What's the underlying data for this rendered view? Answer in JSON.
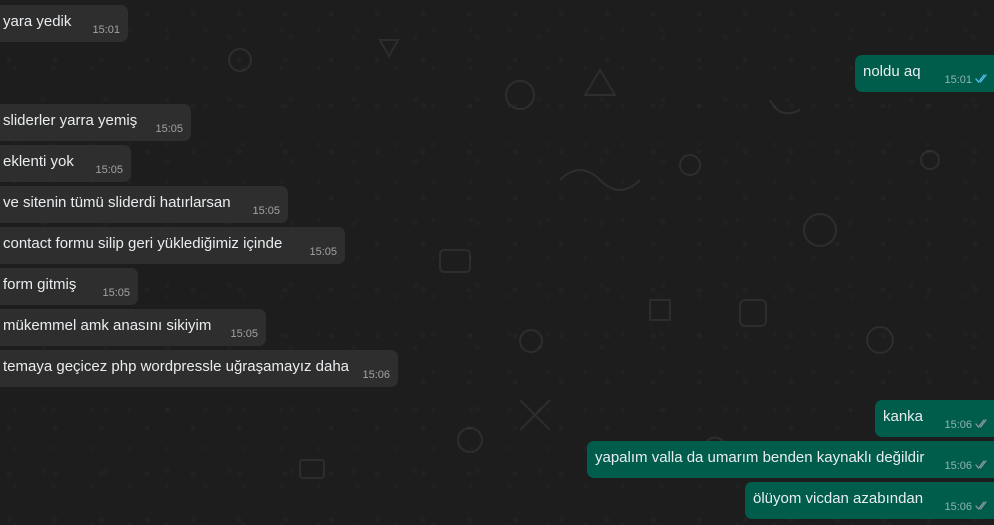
{
  "chat": {
    "messages": [
      {
        "dir": "in",
        "text": "yara yedik",
        "time": "15:01"
      },
      {
        "dir": "out",
        "text": "noldu aq",
        "time": "15:01",
        "status": "read"
      },
      {
        "dir": "in",
        "text": "sliderler yarra yemiş",
        "time": "15:05"
      },
      {
        "dir": "in",
        "text": "eklenti yok",
        "time": "15:05"
      },
      {
        "dir": "in",
        "text": "ve sitenin tümü sliderdi hatırlarsan",
        "time": "15:05"
      },
      {
        "dir": "in",
        "text": "contact formu silip geri yüklediğimiz içinde",
        "time": "15:05"
      },
      {
        "dir": "in",
        "text": "form gitmiş",
        "time": "15:05"
      },
      {
        "dir": "in",
        "text": "mükemmel amk anasını sikiyim",
        "time": "15:05"
      },
      {
        "dir": "in",
        "text": "temaya geçicez php wordpressle uğraşamayız daha",
        "time": "15:06"
      },
      {
        "dir": "out",
        "text": "kanka",
        "time": "15:06",
        "status": "delivered"
      },
      {
        "dir": "out",
        "text": "yapalım valla da umarım benden kaynaklı değildir",
        "time": "15:06",
        "status": "delivered"
      },
      {
        "dir": "out",
        "text": "ölüyom vicdan azabından",
        "time": "15:06",
        "status": "delivered"
      }
    ]
  },
  "colors": {
    "incoming_bubble": "#2e2e2e",
    "outgoing_bubble": "#005c4b",
    "read_tick": "#53bdeb",
    "delivered_tick": "#8696a0"
  },
  "icons": [
    "double-check-read-icon",
    "double-check-delivered-icon"
  ]
}
